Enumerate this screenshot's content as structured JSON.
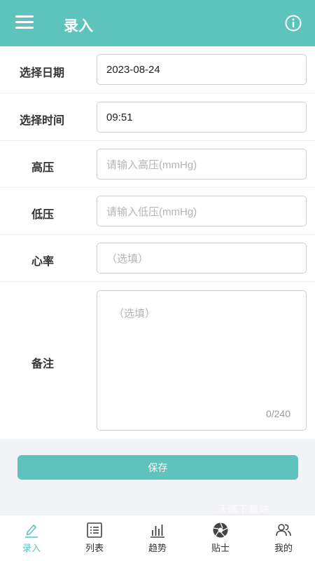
{
  "header": {
    "title": "录入",
    "menu_icon": "menu-icon",
    "info_icon": "info-icon",
    "accent_color": "#5ec2bd"
  },
  "form": {
    "date": {
      "label": "选择日期",
      "value": "2023-08-24"
    },
    "time": {
      "label": "选择时间",
      "value": "09:51"
    },
    "systolic": {
      "label": "高压",
      "placeholder": "请输入高压(mmHg)"
    },
    "diastolic": {
      "label": "低压",
      "placeholder": "请输入低压(mmHg)"
    },
    "heart_rate": {
      "label": "心率",
      "placeholder": "（选填）"
    },
    "notes": {
      "label": "备注",
      "placeholder": "（选填）",
      "counter": "0/240"
    }
  },
  "actions": {
    "save_label": "保存"
  },
  "watermark": "沃德下载站",
  "tabs": [
    {
      "label": "录入",
      "icon": "edit-icon",
      "active": true
    },
    {
      "label": "列表",
      "icon": "list-icon",
      "active": false
    },
    {
      "label": "趋势",
      "icon": "bar-chart-icon",
      "active": false
    },
    {
      "label": "贴士",
      "icon": "aperture-icon",
      "active": false
    },
    {
      "label": "我的",
      "icon": "users-icon",
      "active": false
    }
  ]
}
